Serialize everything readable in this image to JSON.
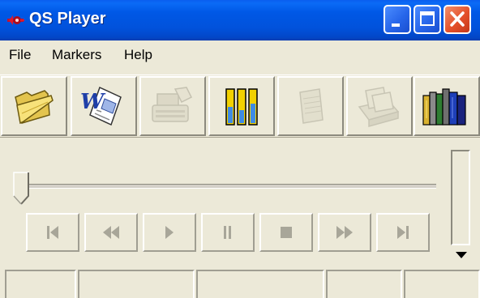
{
  "window": {
    "title": "QS Player",
    "icon": "app-logo-icon",
    "controls": [
      "minimize-icon",
      "maximize-icon",
      "close-icon"
    ],
    "colors": {
      "titlebar": "#0058E6",
      "close": "#E4502A",
      "face": "#ECE9D8"
    }
  },
  "menu": {
    "items": [
      {
        "label": "File"
      },
      {
        "label": "Markers"
      },
      {
        "label": "Help"
      }
    ]
  },
  "toolbar": {
    "buttons": [
      {
        "icon": "folder-open-icon",
        "enabled": true
      },
      {
        "icon": "word-document-icon",
        "enabled": true
      },
      {
        "icon": "typewriter-icon",
        "enabled": false
      },
      {
        "icon": "level-meters-icon",
        "enabled": true
      },
      {
        "icon": "notepad-icon",
        "enabled": false
      },
      {
        "icon": "card-index-icon",
        "enabled": false
      },
      {
        "icon": "books-icon",
        "enabled": true
      }
    ]
  },
  "playback": {
    "position": 0,
    "volume_arrow": "triangle-down-icon",
    "transport": [
      {
        "icon": "skip-to-start-icon",
        "enabled": false
      },
      {
        "icon": "rewind-icon",
        "enabled": false
      },
      {
        "icon": "play-icon",
        "enabled": false
      },
      {
        "icon": "pause-icon",
        "enabled": false
      },
      {
        "icon": "stop-icon",
        "enabled": false
      },
      {
        "icon": "fast-forward-icon",
        "enabled": false
      },
      {
        "icon": "skip-to-end-icon",
        "enabled": false
      }
    ]
  },
  "statusbar": {
    "panes": [
      "",
      "",
      "",
      "",
      ""
    ]
  }
}
